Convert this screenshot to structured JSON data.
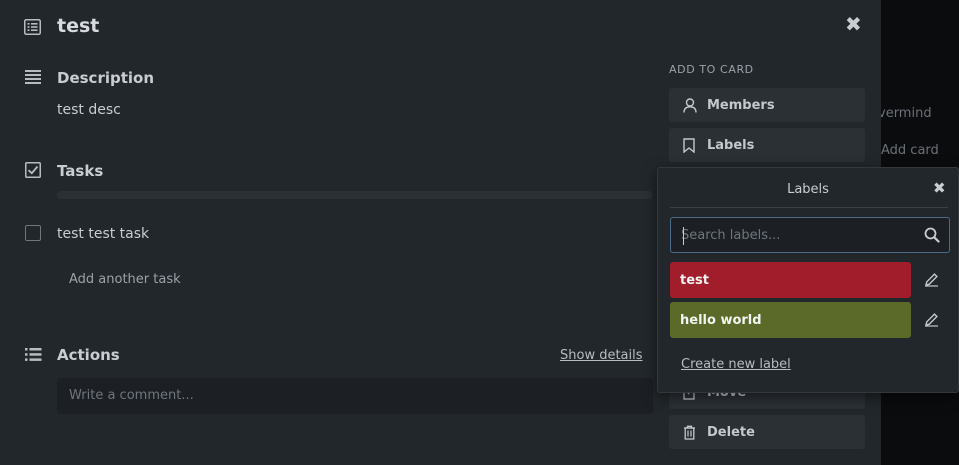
{
  "card": {
    "title": "test"
  },
  "description": {
    "heading": "Description",
    "text": "test desc"
  },
  "tasks": {
    "heading": "Tasks",
    "items": [
      {
        "label": "test test task",
        "checked": false
      }
    ],
    "add_label": "Add another task"
  },
  "actions": {
    "heading": "Actions",
    "show_details": "Show details",
    "comment_placeholder": "Write a comment..."
  },
  "sidebar": {
    "heading": "ADD TO CARD",
    "members": "Members",
    "labels": "Labels",
    "move": "Move",
    "delete": "Delete"
  },
  "background": {
    "list_title_fragment": "vermind",
    "add_card_fragment": "Add card"
  },
  "labels_popover": {
    "title": "Labels",
    "search_placeholder": "Search labels...",
    "labels": [
      {
        "name": "test",
        "color": "#a21d2b"
      },
      {
        "name": "hello world",
        "color": "#5b6a29"
      }
    ],
    "create_label": "Create new label"
  },
  "icons": {
    "card": "card-icon",
    "description": "lines-icon",
    "tasks": "checkbox-icon",
    "actions": "list-icon",
    "members": "user-icon",
    "labels": "bookmark-icon",
    "move": "move-icon",
    "delete": "trash-icon",
    "search": "search-icon",
    "edit": "pencil-icon",
    "close": "close-icon"
  }
}
